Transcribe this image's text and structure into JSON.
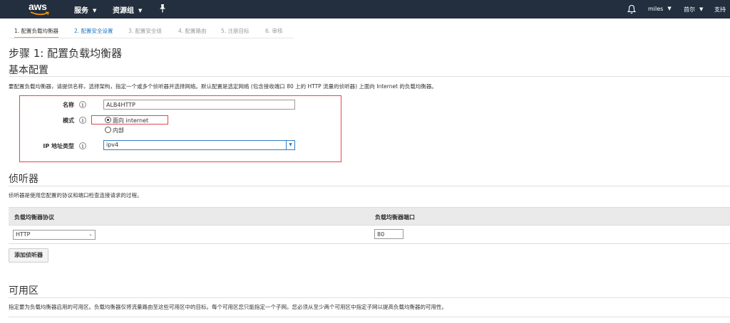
{
  "nav": {
    "logo": "aws",
    "services": "服务",
    "resource_groups": "资源组",
    "user": "miles",
    "region": "首尔",
    "support": "支持"
  },
  "steps": [
    {
      "label": "1. 配置负载均衡器",
      "state": "active"
    },
    {
      "label": "2. 配置安全设置",
      "state": "link"
    },
    {
      "label": "3. 配置安全组",
      "state": "disabled"
    },
    {
      "label": "4. 配置路由",
      "state": "disabled"
    },
    {
      "label": "5. 注册目标",
      "state": "disabled"
    },
    {
      "label": "6. 审核",
      "state": "disabled"
    }
  ],
  "page_title": "步骤 1: 配置负载均衡器",
  "basic": {
    "title": "基本配置",
    "description": "要配置负载均衡器，请提供名称，选择架构，指定一个或多个侦听器并选择网络。默认配置是选定网络 (包含接收端口 80 上的 HTTP 流量的侦听器) 上面向 Internet 的负载均衡器。",
    "name_label": "名称",
    "name_value": "ALB4HTTP",
    "scheme_label": "模式",
    "scheme_options": [
      "面向 internet",
      "内部"
    ],
    "scheme_selected": "面向 internet",
    "ip_label": "IP 地址类型",
    "ip_value": "ipv4",
    "info_glyph": "i"
  },
  "listeners": {
    "title": "侦听器",
    "description": "侦听器是使用您配置的协议和端口检查连接请求的过程。",
    "col_protocol": "负载均衡器协议",
    "col_port": "负载均衡器端口",
    "protocol_value": "HTTP",
    "port_value": "80",
    "add_button": "添加侦听器"
  },
  "availability": {
    "title": "可用区",
    "description": "指定要为负载均衡器启用的可用区。负载均衡器仅将流量路由至这些可用区中的目标。每个可用区您只能指定一个子网。您必须从至少两个可用区中指定子网以提高负载均衡器的可用性。"
  },
  "colors": {
    "nav_bg": "#232f3e",
    "accent": "#ff9900",
    "highlight": "#e0474c",
    "link": "#1f77c4"
  }
}
